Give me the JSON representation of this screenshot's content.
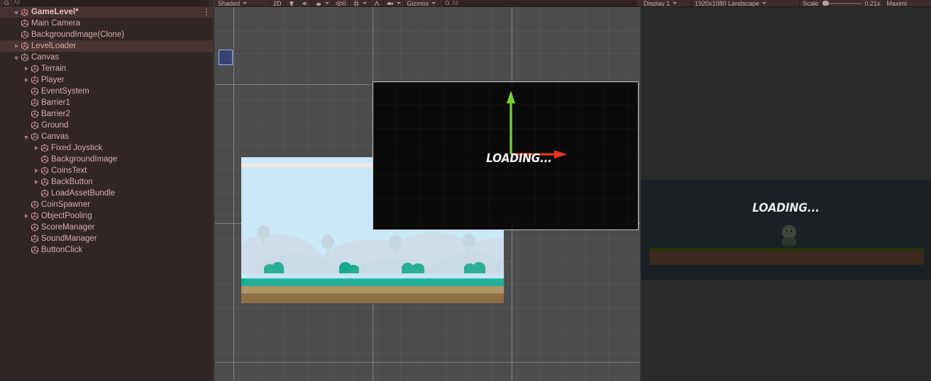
{
  "hierarchy": {
    "search_placeholder": "All",
    "search_value": "",
    "scene_name": "GameLevel*",
    "items": [
      {
        "label": "Main Camera",
        "depth": 1,
        "arrow": "none"
      },
      {
        "label": "BackgroundImage(Clone)",
        "depth": 1,
        "arrow": "none"
      },
      {
        "label": "LevelLoader",
        "depth": 1,
        "arrow": "closed",
        "selected": true
      },
      {
        "label": "Canvas",
        "depth": 1,
        "arrow": "open"
      },
      {
        "label": "Terrain",
        "depth": 2,
        "arrow": "closed"
      },
      {
        "label": "Player",
        "depth": 2,
        "arrow": "closed"
      },
      {
        "label": "EventSystem",
        "depth": 2,
        "arrow": "none"
      },
      {
        "label": "Barrier1",
        "depth": 2,
        "arrow": "none"
      },
      {
        "label": "Barrier2",
        "depth": 2,
        "arrow": "none"
      },
      {
        "label": "Ground",
        "depth": 2,
        "arrow": "none"
      },
      {
        "label": "Canvas",
        "depth": 2,
        "arrow": "open"
      },
      {
        "label": "Fixed Joystick",
        "depth": 3,
        "arrow": "closed"
      },
      {
        "label": "BackgroundImage",
        "depth": 3,
        "arrow": "none"
      },
      {
        "label": "CoinsText",
        "depth": 3,
        "arrow": "closed"
      },
      {
        "label": "BackButton",
        "depth": 3,
        "arrow": "closed"
      },
      {
        "label": "LoadAssetBundle",
        "depth": 3,
        "arrow": "none"
      },
      {
        "label": "CoinSpawner",
        "depth": 2,
        "arrow": "none"
      },
      {
        "label": "ObjectPooling",
        "depth": 2,
        "arrow": "closed"
      },
      {
        "label": "ScoreManager",
        "depth": 2,
        "arrow": "none"
      },
      {
        "label": "SoundManager",
        "depth": 2,
        "arrow": "none"
      },
      {
        "label": "ButtonClick",
        "depth": 2,
        "arrow": "none"
      }
    ]
  },
  "scene_view": {
    "toolbar": {
      "shading_mode": "Shaded",
      "mode_2d": "2D",
      "lighting_icon": "lightbulb-icon",
      "audio_icon": "speaker-icon",
      "fx_icon": "effects-icon",
      "hidden_count": "0",
      "hidden_icon": "eye-icon",
      "grid_icon": "grid-icon",
      "snap_icon": "snap-icon",
      "camera_icon": "scene-camera-icon",
      "gizmos_label": "Gizmos",
      "search_placeholder": "All",
      "search_value": ""
    },
    "loading_text": "LOADING...",
    "gizmo": {
      "y_axis_color": "#76d430",
      "x_axis_color": "#e8351a",
      "handle_color": "#2b3f96"
    },
    "selection_outline_color": "#c8c8c8",
    "background_art": {
      "sky_color": "#cbe8f7",
      "cloud_color": "#ece9e3",
      "hill_color": "#b9d3e0",
      "bush_color": "#17a98c",
      "grass_color": "#0fab8e",
      "dirt_color": "#b28d56"
    }
  },
  "game_view": {
    "toolbar": {
      "display_label": "Display 1",
      "resolution_label": "1920x1080 Landscape",
      "scale_label": "Scale",
      "scale_value": "0.21x",
      "maximize_label": "Maximi"
    },
    "loading_text": "LOADING...",
    "character": "player-sprite",
    "ground_top_color": "#243308",
    "ground_body_color": "#3a291c"
  }
}
